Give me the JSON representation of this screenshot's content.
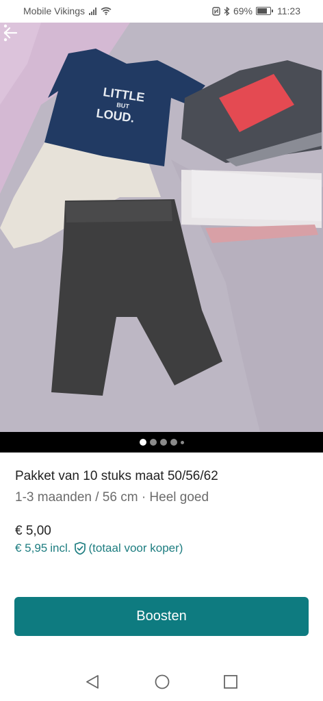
{
  "status_bar": {
    "carrier": "Mobile Vikings",
    "battery": "69%",
    "time": "11:23"
  },
  "photo": {
    "shirt_text_line1": "LITTLE",
    "shirt_text_line2": "BUT",
    "shirt_text_line3": "LOUD."
  },
  "carousel": {
    "total_dots": 5,
    "active_index": 0
  },
  "listing": {
    "title": "Pakket van 10 stuks maat 50/56/62",
    "subtitle": "1-3 maanden / 56 cm · Heel goed",
    "price": "€ 5,00",
    "price_incl": "€ 5,95",
    "incl_label": "incl.",
    "total_note": "(totaal voor koper)"
  },
  "actions": {
    "boost_label": "Boosten"
  },
  "colors": {
    "accent": "#0e7b80",
    "price_incl": "#1d7d80"
  }
}
